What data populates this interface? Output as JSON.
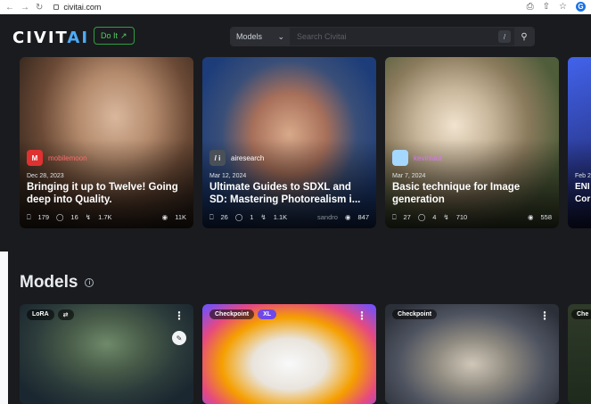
{
  "browser": {
    "url": "civitai.com"
  },
  "header": {
    "logo_main": "CIVIT",
    "logo_accent": "AI",
    "doit_label": "Do It",
    "search_type": "Models",
    "search_placeholder": "Search Civitai",
    "slash_key": "/"
  },
  "articles": [
    {
      "author": "mobilemoon",
      "avatar": "M",
      "date": "Dec 28, 2023",
      "title": "Bringing it up to Twelve! Going deep into Quality.",
      "likes": "179",
      "comments": "16",
      "tips": "1.7K",
      "views": "11K"
    },
    {
      "author": "airesearch",
      "avatar": "/ i",
      "date": "Mar 12, 2024",
      "title": "Ultimate Guides to SDXL and SD: Mastering Photorealism i...",
      "likes": "26",
      "comments": "1",
      "tips": "1.1K",
      "views": "847",
      "watermark": "sandro"
    },
    {
      "author": "kevinlaut",
      "avatar": "",
      "date": "Mar 7, 2024",
      "title": "Basic technique for Image generation",
      "likes": "27",
      "comments": "4",
      "tips": "710",
      "views": "558"
    },
    {
      "author": "",
      "avatar": "",
      "date": "Feb 2",
      "title": "ENI Cor",
      "likes": "",
      "comments": "",
      "tips": "",
      "views": ""
    }
  ],
  "models_section": {
    "title": "Models"
  },
  "models": [
    {
      "badge": "LoRA"
    },
    {
      "badge": "Checkpoint",
      "badge2": "XL"
    },
    {
      "badge": "Checkpoint"
    },
    {
      "badge": "Che"
    }
  ],
  "colors": {
    "accent": "#4dabf7",
    "background": "#1a1b1e",
    "doit": "#51cf66"
  }
}
